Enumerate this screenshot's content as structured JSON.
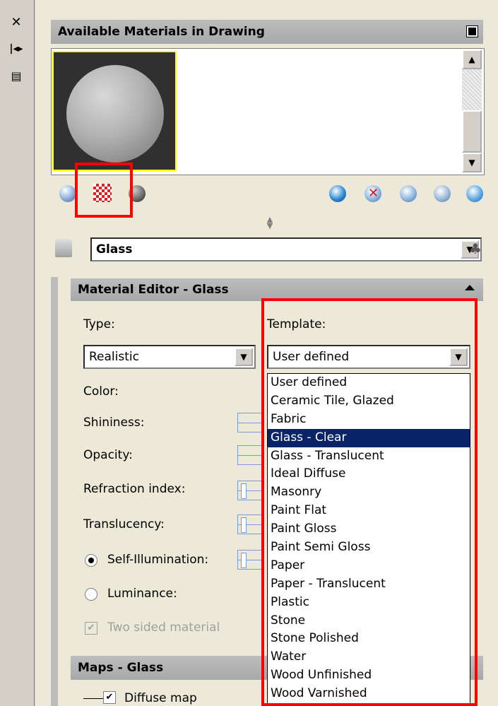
{
  "side_strip": {
    "close_icon": "close-icon",
    "autohide_icon": "autohide-icon",
    "properties_icon": "properties-icon"
  },
  "available_materials": {
    "title": "Available Materials in Drawing",
    "swatch_highlight_color": "#ffff00"
  },
  "toolbar": {
    "left_icons": [
      "swatch-geometry-icon",
      "checkered-underlay-icon",
      "render-preview-icon"
    ],
    "right_icons": [
      "create-new-material-icon",
      "purge-from-drawing-icon",
      "indicate-materials-in-use-icon",
      "apply-to-objects-icon",
      "remove-materials-icon"
    ]
  },
  "material_selector": {
    "name": "Glass"
  },
  "material_editor": {
    "title": "Material Editor - Glass",
    "type_label": "Type:",
    "type_value": "Realistic",
    "template_label": "Template:",
    "template_value": "User defined",
    "color_label": "Color:",
    "shininess_label": "Shininess:",
    "opacity_label": "Opacity:",
    "refraction_label": "Refraction index:",
    "translucency_label": "Translucency:",
    "self_illumination_label": "Self-Illumination:",
    "luminance_label": "Luminance:",
    "two_sided_label": "Two sided material",
    "self_illumination_selected": true,
    "two_sided_checked": true
  },
  "maps": {
    "title": "Maps - Glass",
    "diffuse_label": "Diffuse map"
  },
  "template_dropdown": {
    "selected_index": 3,
    "options": [
      "User defined",
      "Ceramic Tile, Glazed",
      "Fabric",
      "Glass - Clear",
      "Glass - Translucent",
      "Ideal Diffuse",
      "Masonry",
      "Paint Flat",
      "Paint Gloss",
      "Paint Semi Gloss",
      "Paper",
      "Paper - Translucent",
      "Plastic",
      "Stone",
      "Stone Polished",
      "Water",
      "Wood Unfinished",
      "Wood Varnished"
    ]
  },
  "colors": {
    "highlight_red": "#ff0000",
    "selection_blue": "#0a246a"
  }
}
